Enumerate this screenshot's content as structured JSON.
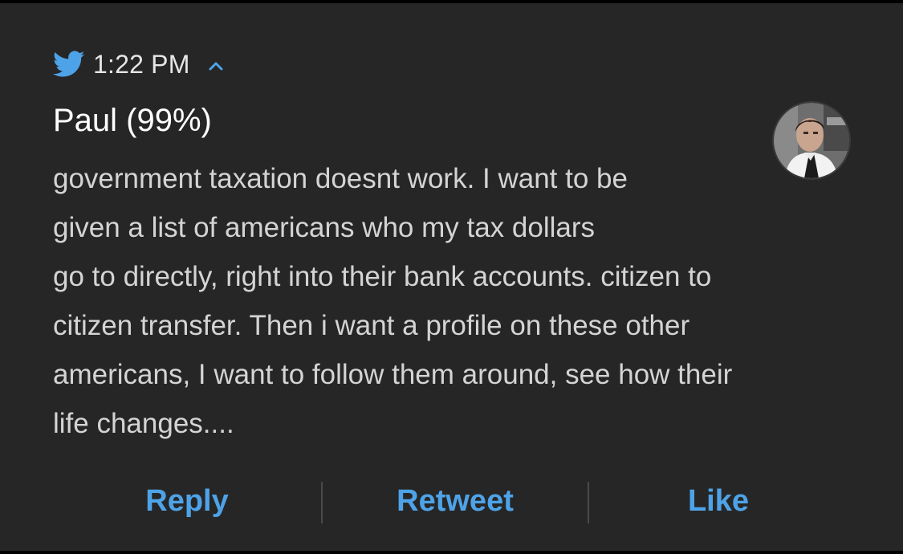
{
  "notification": {
    "time": "1:22 PM",
    "author": "Paul (99%)",
    "body_lines": [
      "government taxation doesnt work. I want to be",
      "given a list of americans who my tax dollars",
      "go to directly, right into their bank accounts. citizen to",
      "citizen transfer. Then i want a profile on these other",
      "americans, I want to follow them around, see how their",
      "life changes...."
    ],
    "app_icon": "twitter-bird-icon",
    "expand_icon": "chevron-up-icon"
  },
  "actions": {
    "reply_label": "Reply",
    "retweet_label": "Retweet",
    "like_label": "Like"
  },
  "colors": {
    "background": "#262626",
    "accent": "#4ea3e8",
    "body_text": "#d4d4d4"
  }
}
